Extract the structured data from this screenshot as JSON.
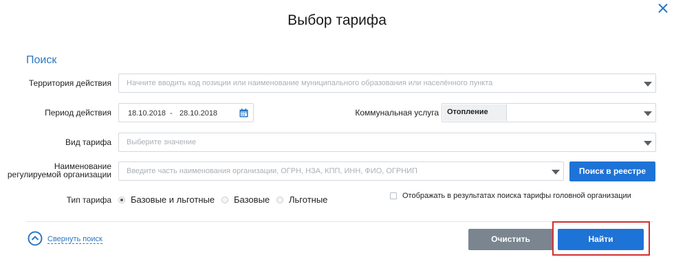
{
  "dialog": {
    "title": "Выбор тарифа",
    "close_icon": "close-icon"
  },
  "search": {
    "section_label": "Поиск",
    "territory": {
      "label": "Территория действия",
      "placeholder": "Начните вводить код позиции или наименование муниципального образования или населённого пункта"
    },
    "period": {
      "label": "Период действия",
      "date_from": "18.10.2018",
      "separator": "-",
      "date_to": "28.10.2018",
      "icon": "calendar-icon"
    },
    "service": {
      "label": "Коммунальная услуга",
      "selected": "Отопление"
    },
    "tariff_kind": {
      "label": "Вид тарифа",
      "placeholder": "Выберите значение"
    },
    "organization": {
      "label_line1": "Наименование",
      "label_line2": "регулируемой организации",
      "placeholder": "Введите часть наименования организации, ОГРН, НЗА, КПП, ИНН, ФИО, ОГРНИП",
      "registry_button": "Поиск в реестре"
    },
    "tariff_type": {
      "label": "Тип тарифа",
      "options": [
        "Базовые и льготные",
        "Базовые",
        "Льготные"
      ],
      "selected_index": 0
    },
    "head_org_checkbox": {
      "label": "Отображать в результатах поиска тарифы головной организации",
      "checked": false
    }
  },
  "footer": {
    "collapse_label": "Свернуть поиск",
    "clear_button": "Очистить",
    "find_button": "Найти"
  },
  "colors": {
    "accent": "#1e73d6",
    "link": "#2a77c2",
    "clear_button": "#7a8590",
    "highlight": "#d32f2f"
  }
}
